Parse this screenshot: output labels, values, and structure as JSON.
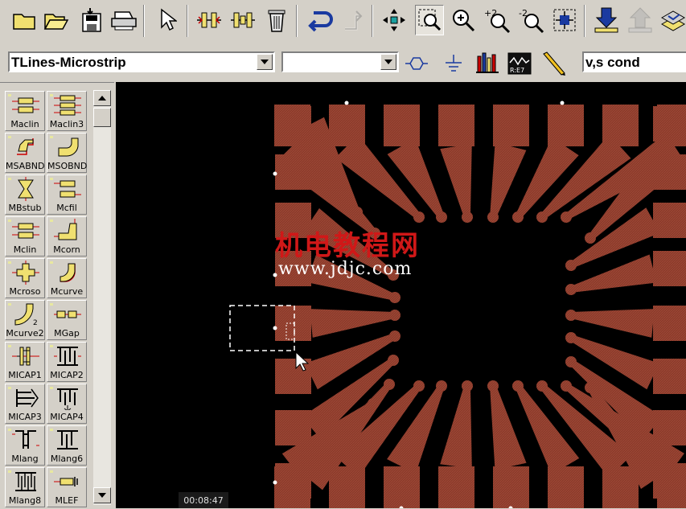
{
  "toolbar": {
    "buttons": [
      {
        "name": "new-icon"
      },
      {
        "name": "open-icon"
      },
      {
        "name": "save-icon"
      },
      {
        "name": "print-icon"
      },
      {
        "name": "select-pointer-icon"
      },
      {
        "name": "insert-component-icon"
      },
      {
        "name": "insert-component-2-icon"
      },
      {
        "name": "delete-icon"
      },
      {
        "name": "undo-icon"
      },
      {
        "name": "redo-icon"
      },
      {
        "name": "move-icon"
      },
      {
        "name": "zoom-area-icon"
      },
      {
        "name": "zoom-in-icon"
      },
      {
        "name": "zoom-in-2-icon"
      },
      {
        "name": "zoom-out-2-icon"
      },
      {
        "name": "zoom-fit-icon"
      },
      {
        "name": "push-down-icon"
      },
      {
        "name": "pop-up-icon"
      },
      {
        "name": "layers-icon"
      }
    ]
  },
  "toolbar2": {
    "library_combo": "TLines-Microstrip",
    "second_combo": "",
    "layer_combo": "v,s cond"
  },
  "palette": {
    "items": [
      "Maclin",
      "Maclin3",
      "MSABND",
      "MSOBND",
      "MBstub",
      "Mcfil",
      "Mclin",
      "Mcorn",
      "Mcroso",
      "Mcurve",
      "Mcurve2",
      "MGap",
      "MICAP1",
      "MICAP2",
      "MICAP3",
      "MICAP4",
      "Mlang",
      "Mlang6",
      "Mlang8",
      "MLEF"
    ]
  },
  "canvas": {
    "watermark": "机电教程网",
    "watermark_url": "www.jdjc.com",
    "pad_color": "#8b3a2a"
  },
  "video": {
    "timestamp": "00:08:47"
  }
}
